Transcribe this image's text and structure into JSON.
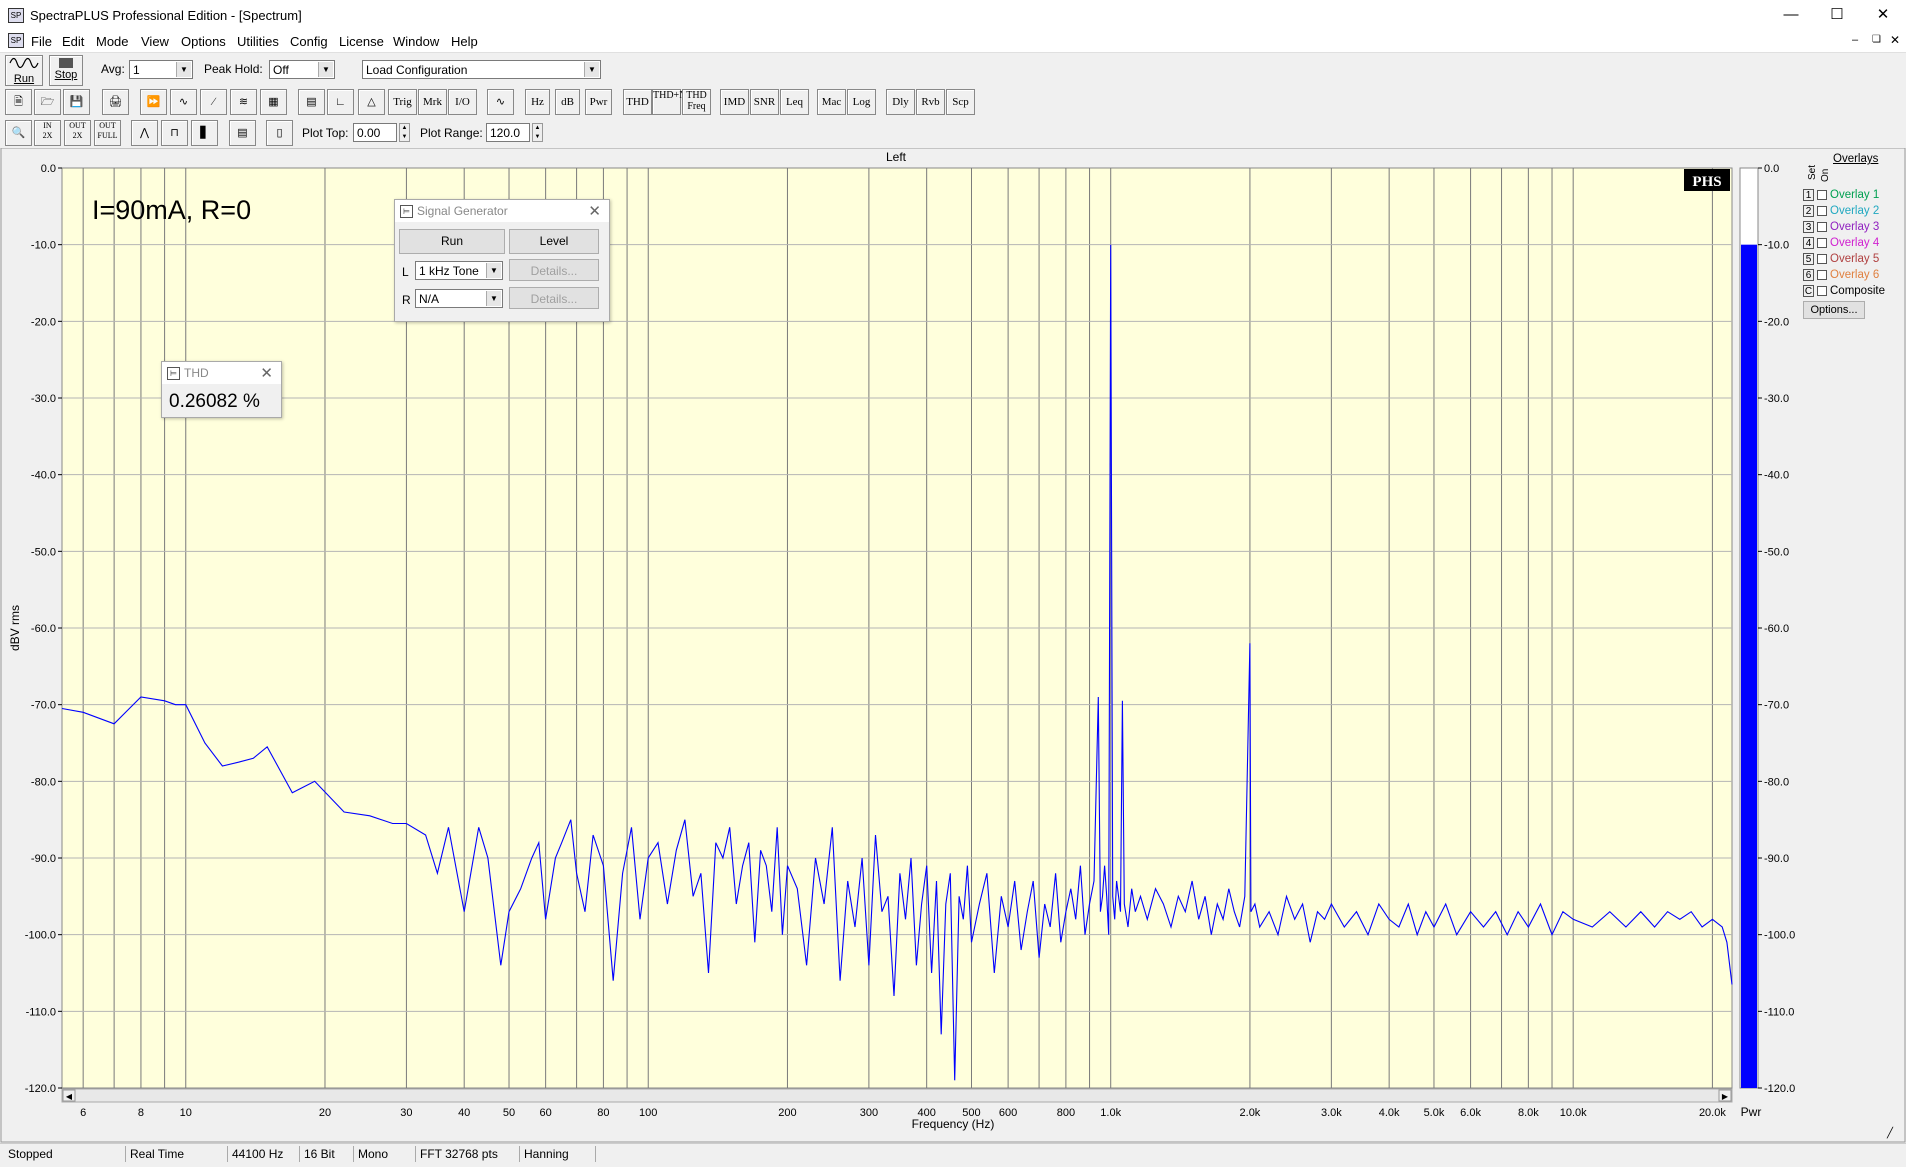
{
  "window": {
    "title": "SpectraPLUS Professional Edition - [Spectrum]"
  },
  "menu": [
    "File",
    "Edit",
    "Mode",
    "View",
    "Options",
    "Utilities",
    "Config",
    "License",
    "Window",
    "Help"
  ],
  "toolbar1": {
    "run_label": "Run",
    "stop_label": "Stop",
    "avg_label": "Avg:",
    "avg_value": "1",
    "peak_hold_label": "Peak Hold:",
    "peak_hold_value": "Off",
    "config_value": "Load Configuration"
  },
  "toolbar2": {
    "buttons": [
      "Trig",
      "Mrk",
      "I/O",
      "Hz",
      "dB",
      "Pwr",
      "THD",
      "THD+N",
      "THD Freq",
      "IMD",
      "SNR",
      "Leq",
      "Mac",
      "Log",
      "Dly",
      "Rvb",
      "Scp"
    ]
  },
  "toolbar3": {
    "plot_top_label": "Plot Top:",
    "plot_top_value": "0.00",
    "plot_range_label": "Plot Range:",
    "plot_range_value": "120.0"
  },
  "plot": {
    "channel_title": "Left",
    "annotation": "I=90mA, R=0",
    "logo": "PHS",
    "meter_label": "Pwr",
    "meter_level_db": -10.0
  },
  "chart_data": {
    "type": "line",
    "xlabel": "Frequency (Hz)",
    "ylabel": "dBV rms",
    "xscale": "log",
    "xlim": [
      5.4,
      22050
    ],
    "ylim": [
      -120,
      0
    ],
    "grid": true,
    "x_ticks": [
      6,
      8,
      10,
      20,
      30,
      40,
      50,
      60,
      80,
      100,
      200,
      300,
      400,
      500,
      600,
      800,
      1000,
      2000,
      3000,
      4000,
      5000,
      6000,
      8000,
      10000,
      20000
    ],
    "x_tick_labels": [
      "6",
      "8",
      "10",
      "20",
      "30",
      "40",
      "50",
      "60",
      "80",
      "100",
      "200",
      "300",
      "400",
      "500",
      "600",
      "800",
      "1.0k",
      "2.0k",
      "3.0k",
      "4.0k",
      "5.0k",
      "6.0k",
      "8.0k",
      "10.0k",
      "20.0k"
    ],
    "y_ticks": [
      0,
      -10,
      -20,
      -30,
      -40,
      -50,
      -60,
      -70,
      -80,
      -90,
      -100,
      -110,
      -120
    ],
    "y_tick_labels": [
      "0.0",
      "-10.0",
      "-20.0",
      "-30.0",
      "-40.0",
      "-50.0",
      "-60.0",
      "-70.0",
      "-80.0",
      "-90.0",
      "-100.0",
      "-110.0",
      "-120.0"
    ],
    "series": [
      {
        "color": "#0000ff",
        "points": [
          [
            5.4,
            -70.5
          ],
          [
            6,
            -71
          ],
          [
            7,
            -72.5
          ],
          [
            8,
            -69
          ],
          [
            9,
            -69.5
          ],
          [
            9.5,
            -70
          ],
          [
            10,
            -70
          ],
          [
            11,
            -75
          ],
          [
            12,
            -78
          ],
          [
            13,
            -77.5
          ],
          [
            14,
            -77
          ],
          [
            15,
            -75.5
          ],
          [
            17,
            -81.5
          ],
          [
            19,
            -80
          ],
          [
            22,
            -84
          ],
          [
            25,
            -84.5
          ],
          [
            28,
            -85.5
          ],
          [
            30,
            -85.5
          ],
          [
            33,
            -87
          ],
          [
            35,
            -92
          ],
          [
            37,
            -86
          ],
          [
            40,
            -97
          ],
          [
            43,
            -86
          ],
          [
            45,
            -90
          ],
          [
            48,
            -104
          ],
          [
            50,
            -97
          ],
          [
            53,
            -94
          ],
          [
            56,
            -90
          ],
          [
            58,
            -88
          ],
          [
            60,
            -98
          ],
          [
            63,
            -90
          ],
          [
            65,
            -88
          ],
          [
            68,
            -85
          ],
          [
            70,
            -92
          ],
          [
            73,
            -97
          ],
          [
            76,
            -87
          ],
          [
            80,
            -91
          ],
          [
            84,
            -106
          ],
          [
            88,
            -92
          ],
          [
            92,
            -86
          ],
          [
            96,
            -98
          ],
          [
            100,
            -90
          ],
          [
            105,
            -88
          ],
          [
            110,
            -96
          ],
          [
            115,
            -89
          ],
          [
            120,
            -85
          ],
          [
            125,
            -95
          ],
          [
            130,
            -92
          ],
          [
            135,
            -105
          ],
          [
            140,
            -88
          ],
          [
            145,
            -90
          ],
          [
            150,
            -86
          ],
          [
            155,
            -96
          ],
          [
            160,
            -91
          ],
          [
            165,
            -88
          ],
          [
            170,
            -101
          ],
          [
            175,
            -89
          ],
          [
            180,
            -91
          ],
          [
            185,
            -97
          ],
          [
            190,
            -86
          ],
          [
            195,
            -100
          ],
          [
            200,
            -91
          ],
          [
            210,
            -94
          ],
          [
            220,
            -104
          ],
          [
            230,
            -90
          ],
          [
            240,
            -96
          ],
          [
            250,
            -86
          ],
          [
            260,
            -106
          ],
          [
            270,
            -93
          ],
          [
            280,
            -99
          ],
          [
            290,
            -90
          ],
          [
            300,
            -104
          ],
          [
            310,
            -87
          ],
          [
            320,
            -97
          ],
          [
            330,
            -95
          ],
          [
            340,
            -108
          ],
          [
            350,
            -92
          ],
          [
            360,
            -98
          ],
          [
            370,
            -90
          ],
          [
            380,
            -104
          ],
          [
            390,
            -96
          ],
          [
            400,
            -91
          ],
          [
            410,
            -105
          ],
          [
            420,
            -93
          ],
          [
            430,
            -113
          ],
          [
            440,
            -96
          ],
          [
            450,
            -92
          ],
          [
            460,
            -119
          ],
          [
            470,
            -95
          ],
          [
            480,
            -98
          ],
          [
            490,
            -91
          ],
          [
            500,
            -101
          ],
          [
            520,
            -96
          ],
          [
            540,
            -92
          ],
          [
            560,
            -105
          ],
          [
            580,
            -95
          ],
          [
            600,
            -99
          ],
          [
            620,
            -93
          ],
          [
            640,
            -102
          ],
          [
            660,
            -97
          ],
          [
            680,
            -93
          ],
          [
            700,
            -103
          ],
          [
            720,
            -96
          ],
          [
            740,
            -99
          ],
          [
            760,
            -92
          ],
          [
            780,
            -101
          ],
          [
            800,
            -97
          ],
          [
            820,
            -94
          ],
          [
            840,
            -98
          ],
          [
            860,
            -91
          ],
          [
            880,
            -100
          ],
          [
            900,
            -96
          ],
          [
            920,
            -93
          ],
          [
            940,
            -69
          ],
          [
            950,
            -97
          ],
          [
            960,
            -95
          ],
          [
            970,
            -91
          ],
          [
            980,
            -95
          ],
          [
            990,
            -100
          ],
          [
            1000,
            -10
          ],
          [
            1010,
            -95
          ],
          [
            1020,
            -98
          ],
          [
            1030,
            -93
          ],
          [
            1050,
            -97
          ],
          [
            1060,
            -69.5
          ],
          [
            1070,
            -96
          ],
          [
            1090,
            -99
          ],
          [
            1110,
            -94
          ],
          [
            1130,
            -97
          ],
          [
            1160,
            -95
          ],
          [
            1200,
            -98
          ],
          [
            1250,
            -94
          ],
          [
            1300,
            -96
          ],
          [
            1350,
            -99
          ],
          [
            1400,
            -95
          ],
          [
            1450,
            -97
          ],
          [
            1500,
            -93
          ],
          [
            1550,
            -98
          ],
          [
            1600,
            -95
          ],
          [
            1650,
            -100
          ],
          [
            1700,
            -96
          ],
          [
            1750,
            -98
          ],
          [
            1800,
            -94
          ],
          [
            1850,
            -97
          ],
          [
            1900,
            -99
          ],
          [
            1950,
            -95
          ],
          [
            2000,
            -62
          ],
          [
            2010,
            -97
          ],
          [
            2050,
            -96
          ],
          [
            2100,
            -99
          ],
          [
            2200,
            -97
          ],
          [
            2300,
            -100
          ],
          [
            2400,
            -95
          ],
          [
            2500,
            -98
          ],
          [
            2600,
            -96
          ],
          [
            2700,
            -101
          ],
          [
            2800,
            -97
          ],
          [
            2900,
            -98
          ],
          [
            3000,
            -96
          ],
          [
            3200,
            -99
          ],
          [
            3400,
            -97
          ],
          [
            3600,
            -100
          ],
          [
            3800,
            -96
          ],
          [
            4000,
            -98
          ],
          [
            4200,
            -99
          ],
          [
            4400,
            -96
          ],
          [
            4600,
            -100
          ],
          [
            4800,
            -97
          ],
          [
            5000,
            -99
          ],
          [
            5300,
            -96
          ],
          [
            5600,
            -100
          ],
          [
            6000,
            -97
          ],
          [
            6400,
            -99
          ],
          [
            6800,
            -97
          ],
          [
            7200,
            -100
          ],
          [
            7600,
            -97
          ],
          [
            8000,
            -99
          ],
          [
            8500,
            -96
          ],
          [
            9000,
            -100
          ],
          [
            9500,
            -97
          ],
          [
            10000,
            -98
          ],
          [
            11000,
            -99
          ],
          [
            12000,
            -97
          ],
          [
            13000,
            -99
          ],
          [
            14000,
            -97
          ],
          [
            15000,
            -99
          ],
          [
            16000,
            -97
          ],
          [
            17000,
            -98
          ],
          [
            18000,
            -97
          ],
          [
            19000,
            -99
          ],
          [
            20000,
            -98
          ],
          [
            21000,
            -99
          ],
          [
            21500,
            -101
          ],
          [
            22050,
            -106.5
          ]
        ]
      }
    ]
  },
  "signal_generator": {
    "title": "Signal Generator",
    "run_label": "Run",
    "level_label": "Level",
    "l_label": "L",
    "l_value": "1 kHz Tone",
    "r_label": "R",
    "r_value": "N/A",
    "details_label": "Details..."
  },
  "thd_window": {
    "title": "THD",
    "value": "0.26082 %"
  },
  "overlays": {
    "header": "Overlays",
    "set_label": "Set",
    "on_label": "On",
    "items": [
      {
        "num": "1",
        "label": "Overlay 1",
        "color": "#00a050"
      },
      {
        "num": "2",
        "label": "Overlay 2",
        "color": "#20a8c0"
      },
      {
        "num": "3",
        "label": "Overlay 3",
        "color": "#9020c0"
      },
      {
        "num": "4",
        "label": "Overlay 4",
        "color": "#d020d0"
      },
      {
        "num": "5",
        "label": "Overlay 5",
        "color": "#b04040"
      },
      {
        "num": "6",
        "label": "Overlay 6",
        "color": "#e08040"
      },
      {
        "num": "C",
        "label": "Composite",
        "color": "#000000"
      }
    ],
    "options_label": "Options..."
  },
  "status": [
    "Stopped",
    "Real Time",
    "44100 Hz",
    "16 Bit",
    "Mono",
    "FFT 32768 pts",
    "Hanning"
  ]
}
